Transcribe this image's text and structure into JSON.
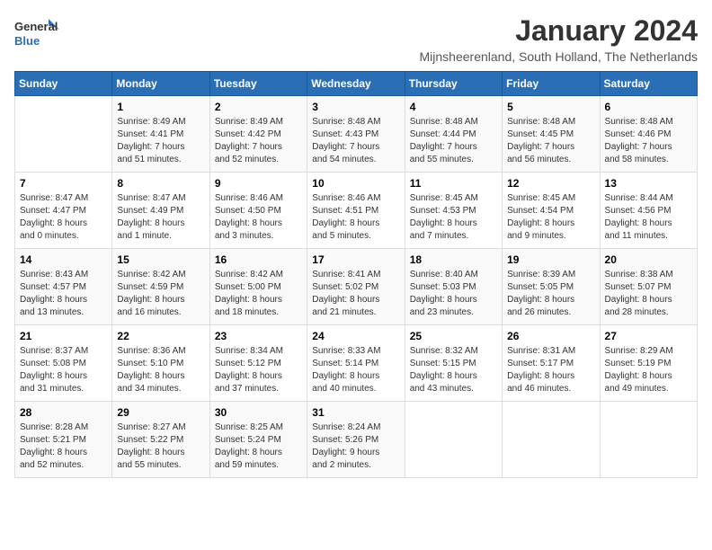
{
  "logo": {
    "line1": "General",
    "line2": "Blue"
  },
  "title": "January 2024",
  "subtitle": "Mijnsheerenland, South Holland, The Netherlands",
  "weekdays": [
    "Sunday",
    "Monday",
    "Tuesday",
    "Wednesday",
    "Thursday",
    "Friday",
    "Saturday"
  ],
  "weeks": [
    [
      {
        "day": "",
        "content": ""
      },
      {
        "day": "1",
        "content": "Sunrise: 8:49 AM\nSunset: 4:41 PM\nDaylight: 7 hours\nand 51 minutes."
      },
      {
        "day": "2",
        "content": "Sunrise: 8:49 AM\nSunset: 4:42 PM\nDaylight: 7 hours\nand 52 minutes."
      },
      {
        "day": "3",
        "content": "Sunrise: 8:48 AM\nSunset: 4:43 PM\nDaylight: 7 hours\nand 54 minutes."
      },
      {
        "day": "4",
        "content": "Sunrise: 8:48 AM\nSunset: 4:44 PM\nDaylight: 7 hours\nand 55 minutes."
      },
      {
        "day": "5",
        "content": "Sunrise: 8:48 AM\nSunset: 4:45 PM\nDaylight: 7 hours\nand 56 minutes."
      },
      {
        "day": "6",
        "content": "Sunrise: 8:48 AM\nSunset: 4:46 PM\nDaylight: 7 hours\nand 58 minutes."
      }
    ],
    [
      {
        "day": "7",
        "content": "Sunrise: 8:47 AM\nSunset: 4:47 PM\nDaylight: 8 hours\nand 0 minutes."
      },
      {
        "day": "8",
        "content": "Sunrise: 8:47 AM\nSunset: 4:49 PM\nDaylight: 8 hours\nand 1 minute."
      },
      {
        "day": "9",
        "content": "Sunrise: 8:46 AM\nSunset: 4:50 PM\nDaylight: 8 hours\nand 3 minutes."
      },
      {
        "day": "10",
        "content": "Sunrise: 8:46 AM\nSunset: 4:51 PM\nDaylight: 8 hours\nand 5 minutes."
      },
      {
        "day": "11",
        "content": "Sunrise: 8:45 AM\nSunset: 4:53 PM\nDaylight: 8 hours\nand 7 minutes."
      },
      {
        "day": "12",
        "content": "Sunrise: 8:45 AM\nSunset: 4:54 PM\nDaylight: 8 hours\nand 9 minutes."
      },
      {
        "day": "13",
        "content": "Sunrise: 8:44 AM\nSunset: 4:56 PM\nDaylight: 8 hours\nand 11 minutes."
      }
    ],
    [
      {
        "day": "14",
        "content": "Sunrise: 8:43 AM\nSunset: 4:57 PM\nDaylight: 8 hours\nand 13 minutes."
      },
      {
        "day": "15",
        "content": "Sunrise: 8:42 AM\nSunset: 4:59 PM\nDaylight: 8 hours\nand 16 minutes."
      },
      {
        "day": "16",
        "content": "Sunrise: 8:42 AM\nSunset: 5:00 PM\nDaylight: 8 hours\nand 18 minutes."
      },
      {
        "day": "17",
        "content": "Sunrise: 8:41 AM\nSunset: 5:02 PM\nDaylight: 8 hours\nand 21 minutes."
      },
      {
        "day": "18",
        "content": "Sunrise: 8:40 AM\nSunset: 5:03 PM\nDaylight: 8 hours\nand 23 minutes."
      },
      {
        "day": "19",
        "content": "Sunrise: 8:39 AM\nSunset: 5:05 PM\nDaylight: 8 hours\nand 26 minutes."
      },
      {
        "day": "20",
        "content": "Sunrise: 8:38 AM\nSunset: 5:07 PM\nDaylight: 8 hours\nand 28 minutes."
      }
    ],
    [
      {
        "day": "21",
        "content": "Sunrise: 8:37 AM\nSunset: 5:08 PM\nDaylight: 8 hours\nand 31 minutes."
      },
      {
        "day": "22",
        "content": "Sunrise: 8:36 AM\nSunset: 5:10 PM\nDaylight: 8 hours\nand 34 minutes."
      },
      {
        "day": "23",
        "content": "Sunrise: 8:34 AM\nSunset: 5:12 PM\nDaylight: 8 hours\nand 37 minutes."
      },
      {
        "day": "24",
        "content": "Sunrise: 8:33 AM\nSunset: 5:14 PM\nDaylight: 8 hours\nand 40 minutes."
      },
      {
        "day": "25",
        "content": "Sunrise: 8:32 AM\nSunset: 5:15 PM\nDaylight: 8 hours\nand 43 minutes."
      },
      {
        "day": "26",
        "content": "Sunrise: 8:31 AM\nSunset: 5:17 PM\nDaylight: 8 hours\nand 46 minutes."
      },
      {
        "day": "27",
        "content": "Sunrise: 8:29 AM\nSunset: 5:19 PM\nDaylight: 8 hours\nand 49 minutes."
      }
    ],
    [
      {
        "day": "28",
        "content": "Sunrise: 8:28 AM\nSunset: 5:21 PM\nDaylight: 8 hours\nand 52 minutes."
      },
      {
        "day": "29",
        "content": "Sunrise: 8:27 AM\nSunset: 5:22 PM\nDaylight: 8 hours\nand 55 minutes."
      },
      {
        "day": "30",
        "content": "Sunrise: 8:25 AM\nSunset: 5:24 PM\nDaylight: 8 hours\nand 59 minutes."
      },
      {
        "day": "31",
        "content": "Sunrise: 8:24 AM\nSunset: 5:26 PM\nDaylight: 9 hours\nand 2 minutes."
      },
      {
        "day": "",
        "content": ""
      },
      {
        "day": "",
        "content": ""
      },
      {
        "day": "",
        "content": ""
      }
    ]
  ]
}
